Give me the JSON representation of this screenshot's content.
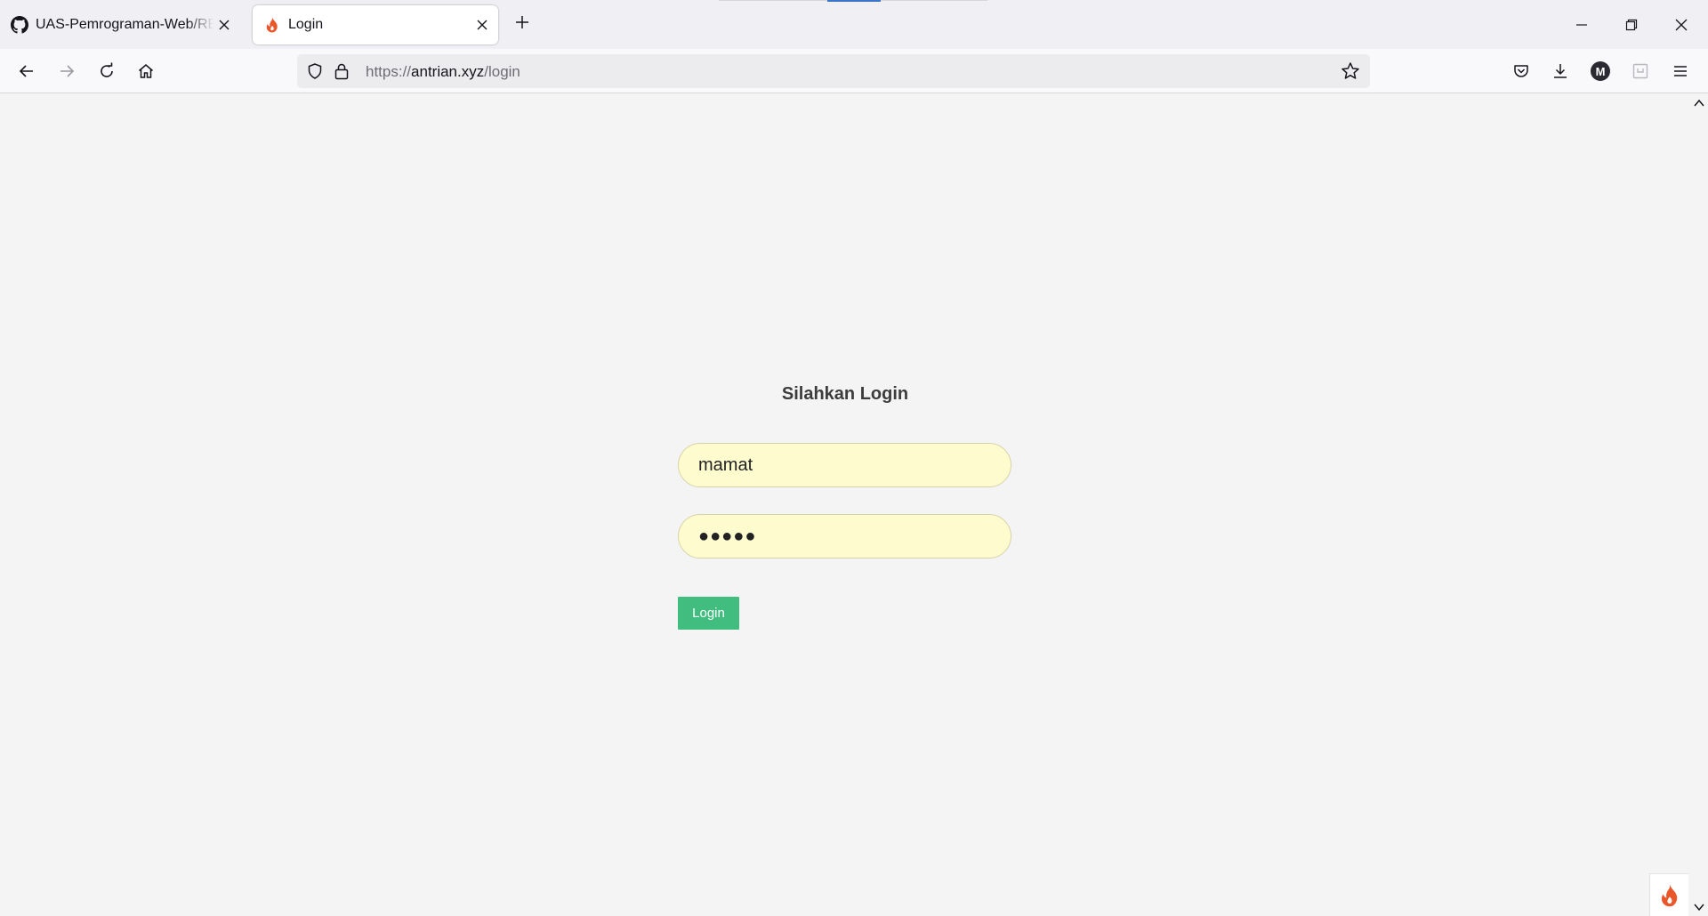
{
  "browser": {
    "tabs": [
      {
        "title": "UAS-Pemrograman-Web/README.md",
        "favicon": "github-icon",
        "active": false
      },
      {
        "title": "Login",
        "favicon": "flame-icon",
        "active": true
      }
    ],
    "url": {
      "scheme": "https://",
      "host": "antrian.xyz",
      "path": "/login"
    },
    "profile_initial": "M"
  },
  "page": {
    "heading": "Silahkan Login",
    "username_value": "mamat",
    "password_mask": "●●●●●",
    "login_button": "Login"
  },
  "colors": {
    "button_green": "#41bd80",
    "autofill_yellow": "#fefbcf",
    "flame_orange": "#e8562a"
  }
}
